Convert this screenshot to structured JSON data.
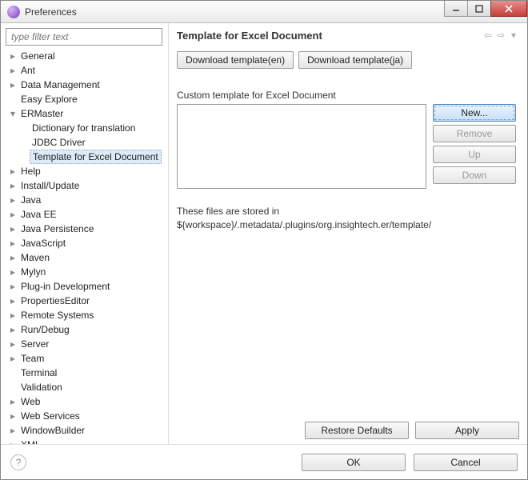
{
  "window": {
    "title": "Preferences"
  },
  "filter": {
    "placeholder": "type filter text"
  },
  "tree": {
    "items": [
      {
        "label": "General",
        "depth": 0,
        "twisty": "closed"
      },
      {
        "label": "Ant",
        "depth": 0,
        "twisty": "closed"
      },
      {
        "label": "Data Management",
        "depth": 0,
        "twisty": "closed"
      },
      {
        "label": "Easy Explore",
        "depth": 0,
        "twisty": "none"
      },
      {
        "label": "ERMaster",
        "depth": 0,
        "twisty": "open"
      },
      {
        "label": "Dictionary for translation",
        "depth": 1,
        "twisty": "none"
      },
      {
        "label": "JDBC Driver",
        "depth": 1,
        "twisty": "none"
      },
      {
        "label": "Template for Excel Document",
        "depth": 1,
        "twisty": "none",
        "selected": true
      },
      {
        "label": "Help",
        "depth": 0,
        "twisty": "closed"
      },
      {
        "label": "Install/Update",
        "depth": 0,
        "twisty": "closed"
      },
      {
        "label": "Java",
        "depth": 0,
        "twisty": "closed"
      },
      {
        "label": "Java EE",
        "depth": 0,
        "twisty": "closed"
      },
      {
        "label": "Java Persistence",
        "depth": 0,
        "twisty": "closed"
      },
      {
        "label": "JavaScript",
        "depth": 0,
        "twisty": "closed"
      },
      {
        "label": "Maven",
        "depth": 0,
        "twisty": "closed"
      },
      {
        "label": "Mylyn",
        "depth": 0,
        "twisty": "closed"
      },
      {
        "label": "Plug-in Development",
        "depth": 0,
        "twisty": "closed"
      },
      {
        "label": "PropertiesEditor",
        "depth": 0,
        "twisty": "closed"
      },
      {
        "label": "Remote Systems",
        "depth": 0,
        "twisty": "closed"
      },
      {
        "label": "Run/Debug",
        "depth": 0,
        "twisty": "closed"
      },
      {
        "label": "Server",
        "depth": 0,
        "twisty": "closed"
      },
      {
        "label": "Team",
        "depth": 0,
        "twisty": "closed"
      },
      {
        "label": "Terminal",
        "depth": 0,
        "twisty": "none"
      },
      {
        "label": "Validation",
        "depth": 0,
        "twisty": "none"
      },
      {
        "label": "Web",
        "depth": 0,
        "twisty": "closed"
      },
      {
        "label": "Web Services",
        "depth": 0,
        "twisty": "closed"
      },
      {
        "label": "WindowBuilder",
        "depth": 0,
        "twisty": "closed"
      },
      {
        "label": "XML",
        "depth": 0,
        "twisty": "closed"
      }
    ]
  },
  "page": {
    "heading": "Template for Excel Document",
    "dl_en": "Download template(en)",
    "dl_ja": "Download template(ja)",
    "custom_label": "Custom template for Excel Document",
    "new_btn": "New...",
    "remove_btn": "Remove",
    "up_btn": "Up",
    "down_btn": "Down",
    "note_line1": "These files are stored in",
    "note_line2": "${workspace}/.metadata/.plugins/org.insightech.er/template/",
    "restore": "Restore Defaults",
    "apply": "Apply"
  },
  "footer": {
    "ok": "OK",
    "cancel": "Cancel",
    "help": "?"
  }
}
